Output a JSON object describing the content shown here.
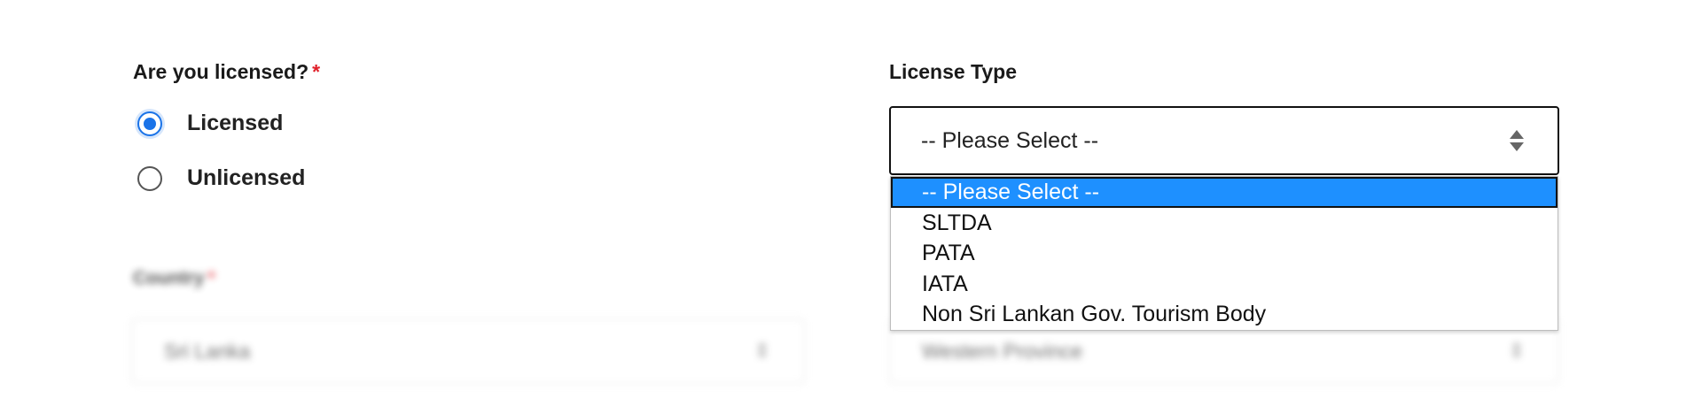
{
  "licensed_question": {
    "label": "Are you licensed?",
    "required_mark": "*",
    "options": [
      {
        "label": "Licensed",
        "checked": true
      },
      {
        "label": "Unlicensed",
        "checked": false
      }
    ]
  },
  "license_type": {
    "label": "License Type",
    "selected_value": "-- Please Select --",
    "options": [
      "-- Please Select --",
      "SLTDA",
      "PATA",
      "IATA",
      "Non Sri Lankan Gov. Tourism Body"
    ]
  },
  "country": {
    "label": "Country",
    "required_mark": "*",
    "value": "Sri Lanka"
  },
  "province": {
    "value": "Western Province"
  },
  "colors": {
    "accent": "#1a73e8",
    "highlight": "#1e90ff",
    "required": "#e0202a"
  },
  "icons": {
    "select_arrows": "sort-arrows-icon"
  }
}
